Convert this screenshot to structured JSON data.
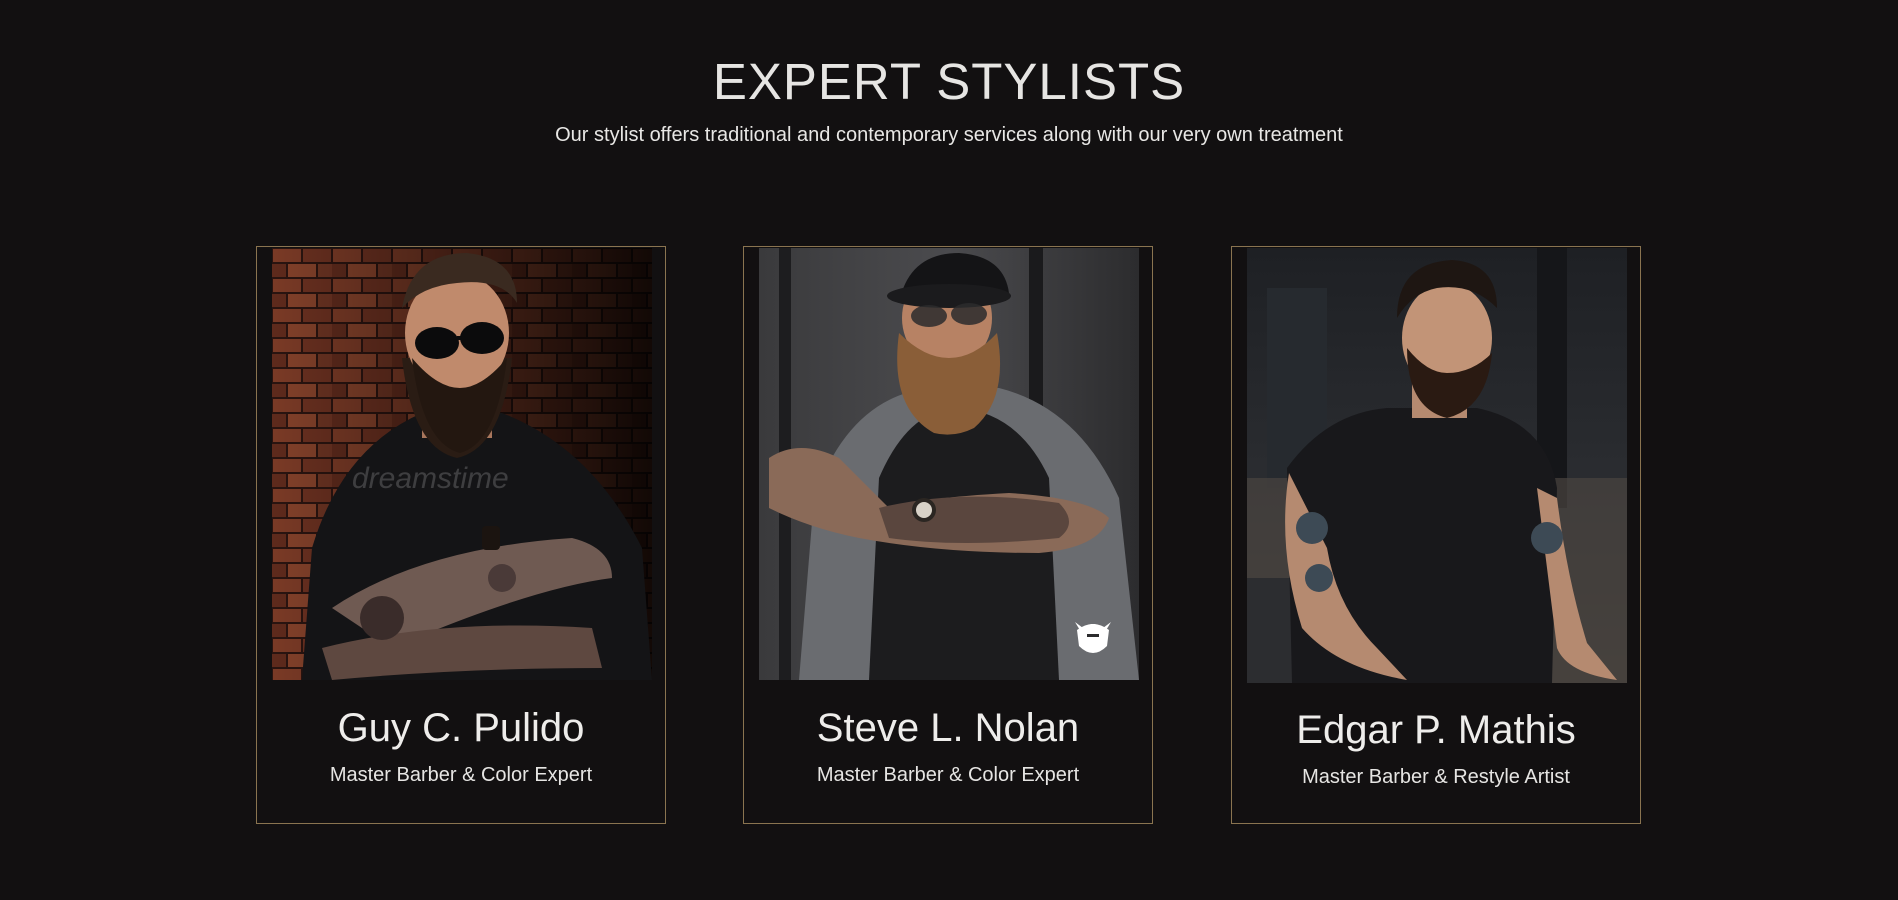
{
  "section": {
    "title": "EXPERT STYLISTS",
    "subtitle": "Our stylist offers traditional and contemporary services along with our very own treatment"
  },
  "stylists": [
    {
      "name": "Guy C. Pulido",
      "role": "Master Barber & Color Expert",
      "photo_watermark": "dreamstime"
    },
    {
      "name": "Steve L. Nolan",
      "role": "Master Barber & Color Expert",
      "photo_badge_icon": "beard-logo-icon"
    },
    {
      "name": "Edgar P. Mathis",
      "role": "Master Barber & Restyle Artist"
    }
  ],
  "colors": {
    "background": "#121011",
    "card_border": "#8a7450",
    "text": "#ecebea"
  }
}
